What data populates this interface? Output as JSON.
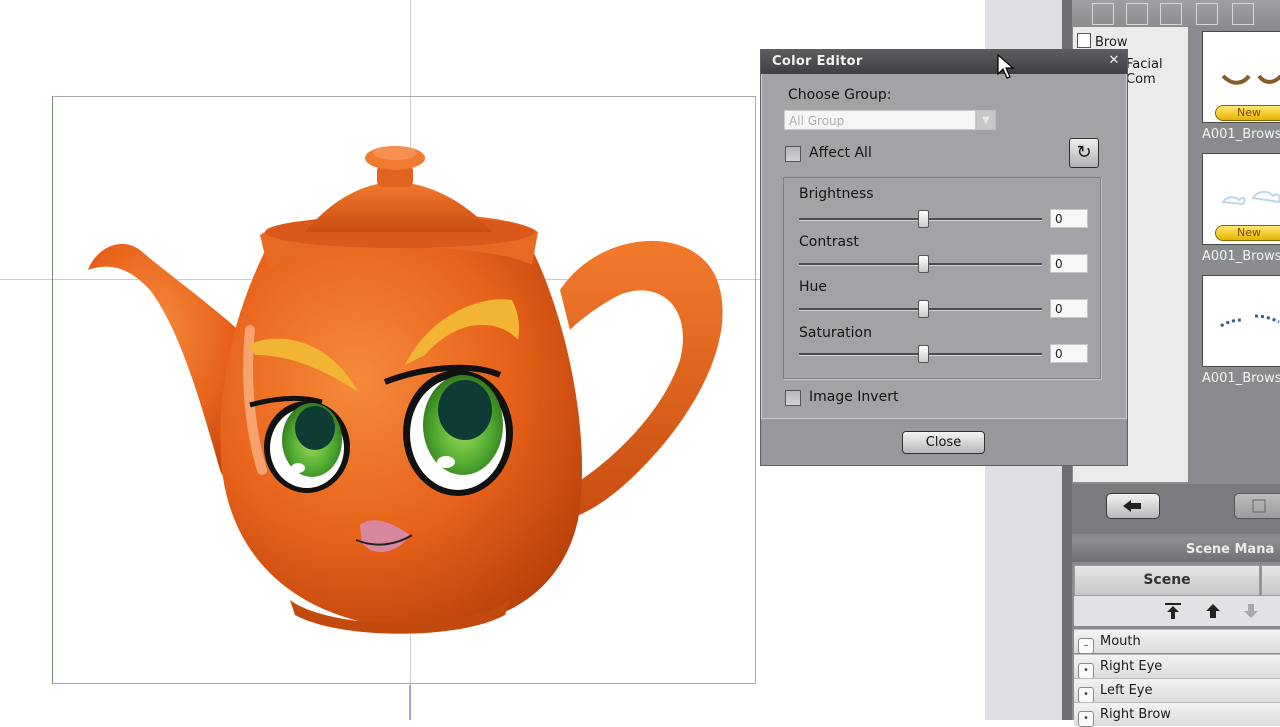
{
  "color_editor": {
    "title": "Color Editor",
    "choose_group_label": "Choose Group:",
    "group_value": "All Group",
    "affect_all_label": "Affect All",
    "affect_all_checked": false,
    "sliders": [
      {
        "label": "Brightness",
        "value": "0"
      },
      {
        "label": "Contrast",
        "value": "0"
      },
      {
        "label": "Hue",
        "value": "0"
      },
      {
        "label": "Saturation",
        "value": "0"
      }
    ],
    "image_invert_label": "Image Invert",
    "image_invert_checked": false,
    "close_button": "Close",
    "close_icon": "close-icon"
  },
  "content_manager": {
    "tree": [
      {
        "label": "Brow"
      },
      {
        "label": "Facial Com"
      }
    ],
    "thumbnails": [
      {
        "label": "A001_Brows",
        "badge": "New"
      },
      {
        "label": "A001_Brows",
        "badge": "New"
      },
      {
        "label": "A001_Brows",
        "badge": ""
      }
    ]
  },
  "scene_manager": {
    "title": "Scene Mana",
    "tab": "Scene",
    "rows": [
      {
        "label": "Mouth"
      },
      {
        "label": "Right Eye"
      },
      {
        "label": "Left Eye"
      },
      {
        "label": "Right Brow"
      }
    ]
  },
  "colors": {
    "teapot": "#e8621a",
    "brow": "#f2b433",
    "iris": "#3f9a2f"
  }
}
